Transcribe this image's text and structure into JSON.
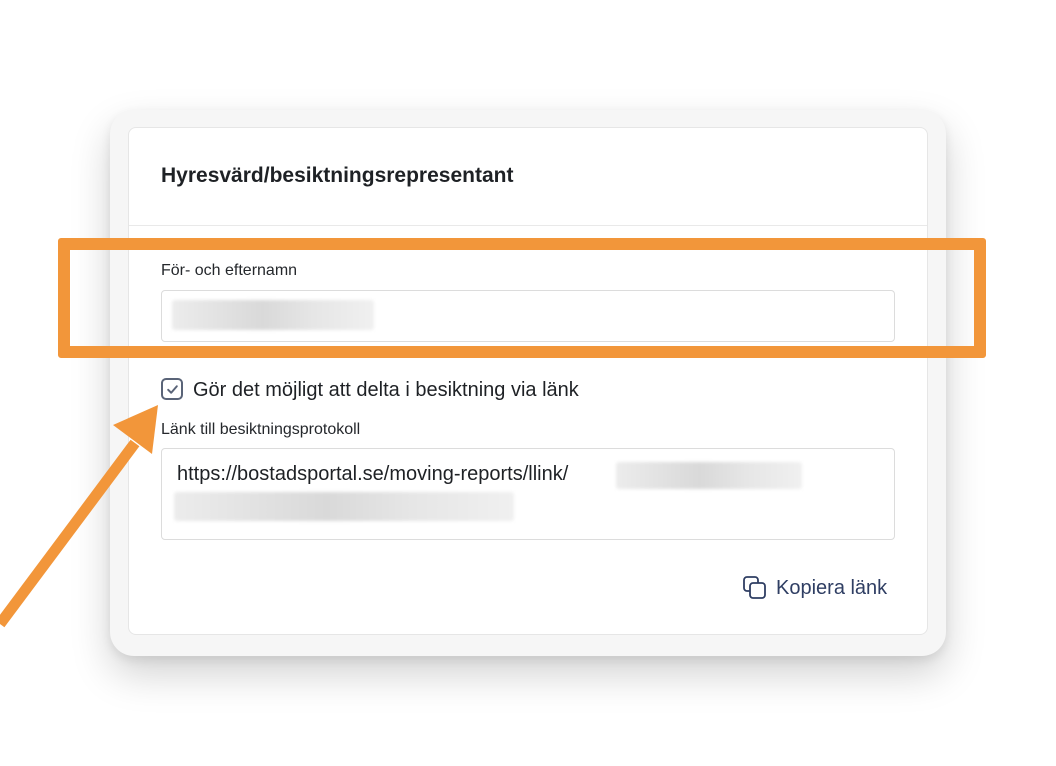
{
  "card": {
    "title": "Hyresvärd/besiktningsrepresentant"
  },
  "name_field": {
    "label": "För- och efternamn",
    "value": ""
  },
  "participation_option": {
    "label": "Gör det möjligt att delta i besiktning via länk",
    "checked": true
  },
  "link_field": {
    "label": "Länk till besiktningsprotokoll",
    "value": "https://bostadsportal.se/moving-reports/llink/"
  },
  "copy_button": {
    "label": "Kopiera länk",
    "icon": "copy-icon"
  },
  "annotation": {
    "highlight_color": "#f2963a",
    "arrow_color": "#f2963a"
  },
  "colors": {
    "text_primary": "#1e2125",
    "checkbox_border": "#5a6478",
    "link_accent": "#2f3e63"
  }
}
